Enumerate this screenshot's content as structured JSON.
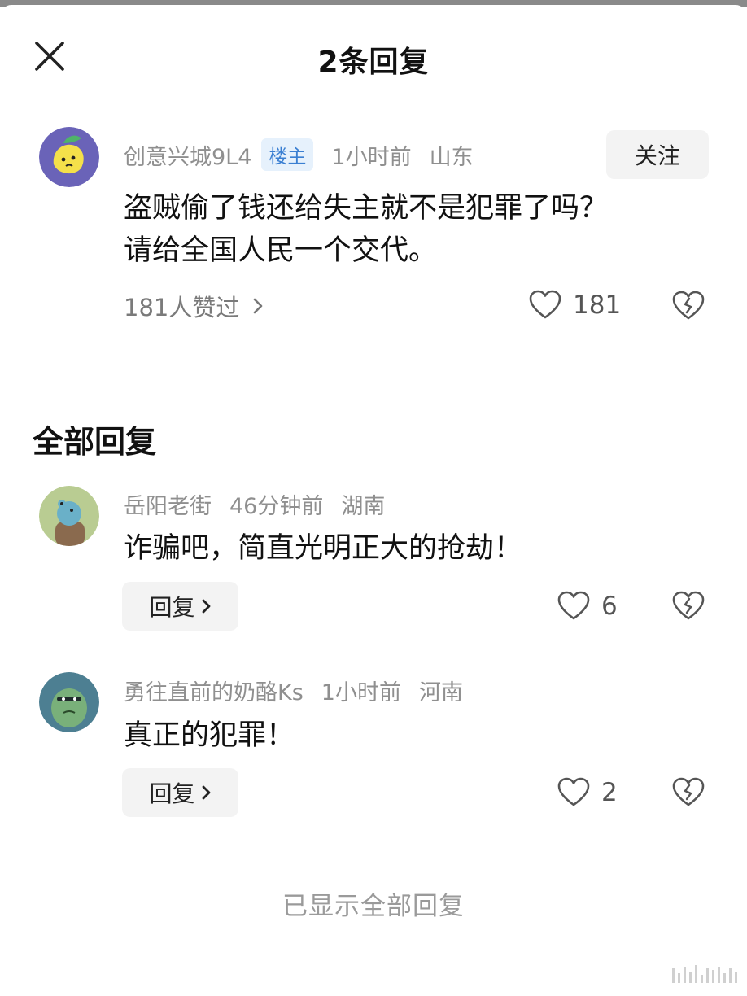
{
  "header": {
    "title": "2条回复"
  },
  "post": {
    "author": "创意兴城9L4",
    "badge": "楼主",
    "time": "1小时前",
    "location": "山东",
    "follow_label": "关注",
    "text_line1": "盗贼偷了钱还给失主就不是犯罪了吗？",
    "text_line2": "请给全国人民一个交代。",
    "liked_by_label": "181人赞过",
    "like_count": "181"
  },
  "replies_section": {
    "title": "全部回复"
  },
  "replies": [
    {
      "author": "岳阳老街",
      "time": "46分钟前",
      "location": "湖南",
      "text": "诈骗吧，简直光明正大的抢劫！",
      "reply_label": "回复",
      "like_count": "6"
    },
    {
      "author": "勇往直前的奶酪Ks",
      "time": "1小时前",
      "location": "河南",
      "text": "真正的犯罪！",
      "reply_label": "回复",
      "like_count": "2"
    }
  ],
  "footer": {
    "note": "已显示全部回复"
  },
  "icons": {
    "close": "close-icon",
    "like": "heart-outline-icon",
    "dislike": "broken-heart-icon",
    "chevron": "chevron-right-icon"
  },
  "colors": {
    "badge_bg": "#e6f1fc",
    "badge_text": "#3a7fd2",
    "meta_gray": "#8f8f8f",
    "button_bg": "#f3f3f3"
  }
}
